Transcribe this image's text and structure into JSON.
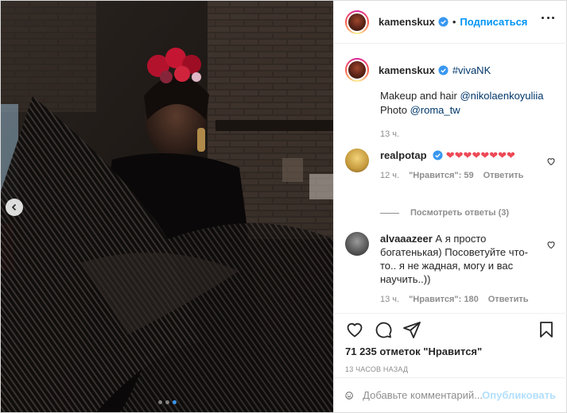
{
  "post": {
    "slides": {
      "count": 3,
      "active_index": 2
    },
    "header": {
      "username": "kamenskux",
      "separator": "•",
      "follow_label": "Подписаться"
    },
    "caption": {
      "username": "kamenskux",
      "hashtag": "#vivaNK",
      "line1_prefix": "Makeup and hair ",
      "line1_mention": "@nikolaenkoyuliia",
      "line2_prefix": "Photo ",
      "line2_mention": "@roma_tw",
      "time": "13 ч."
    },
    "comments": [
      {
        "username": "realpotap",
        "text": "❤❤❤❤❤❤❤❤",
        "time": "12 ч.",
        "likes": "\"Нравится\": 59",
        "reply_label": "Ответить",
        "view_replies": "Посмотреть ответы (3)"
      },
      {
        "username": "alvaaazeer",
        "text": "А я просто богатенькая) Посоветуйте что-то.. я не жадная, могу и вас научить..))",
        "time": "13 ч.",
        "likes": "\"Нравится\": 180",
        "reply_label": "Ответить"
      }
    ],
    "likes_summary": "71 235 отметок \"Нравится\"",
    "timestamp": "13 ЧАСОВ НАЗАД",
    "add_comment": {
      "placeholder": "Добавьте комментарий...",
      "publish_label": "Опубликовать"
    },
    "icons": {
      "like": "heart-icon",
      "comment": "comment-icon",
      "share": "paper-plane-icon",
      "save": "bookmark-icon",
      "emoji": "emoji-icon",
      "verified": "verified-badge-icon",
      "more": "more-options-icon",
      "prev": "chevron-left-icon"
    },
    "colors": {
      "link": "#0095f6",
      "mention": "#00376b",
      "heart": "#ed4956",
      "muted": "#8e8e8e",
      "publish_disabled": "#b2dffc",
      "dot_active": "#3897f0"
    }
  }
}
